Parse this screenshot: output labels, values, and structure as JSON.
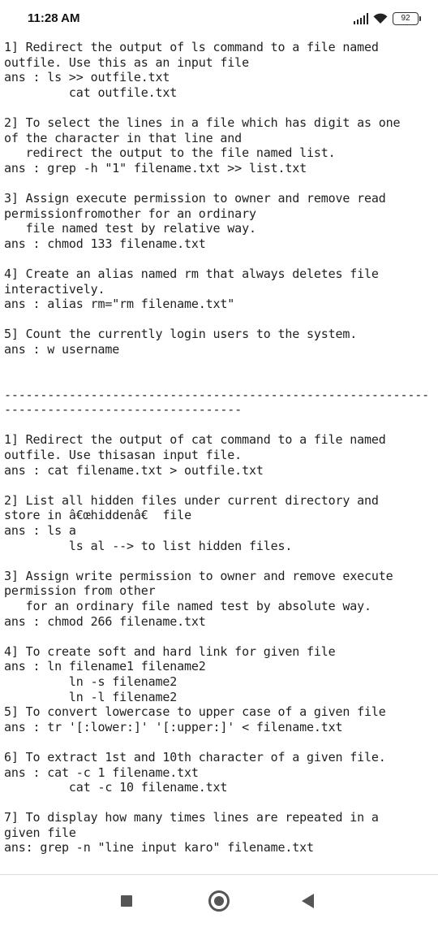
{
  "status_bar": {
    "time": "11:28 AM",
    "battery": "92"
  },
  "lines": [
    "1] Redirect the output of ls command to a file named",
    "outfile. Use this as an input file",
    "ans : ls >> outfile.txt",
    "         cat outfile.txt",
    "",
    "2] To select the lines in a file which has digit as one",
    "of the character in that line and",
    "   redirect the output to the file named list.",
    "ans : grep -h \"1\" filename.txt >> list.txt",
    "",
    "3] Assign execute permission to owner and remove read",
    "permissionfromother for an ordinary",
    "   file named test by relative way.",
    "ans : chmod 133 filename.txt",
    "",
    "4] Create an alias named rm that always deletes file",
    "interactively.",
    "ans : alias rm=\"rm filename.txt\"",
    "",
    "5] Count the currently login users to the system.",
    "ans : w username",
    "",
    "",
    "-----------------------------------------------------------",
    "---------------------------------",
    "",
    "1] Redirect the output of cat command to a file named",
    "outfile. Use thisasan input file.",
    "ans : cat filename.txt > outfile.txt",
    "",
    "2] List all hidden files under current directory and",
    "store in â€œhiddenâ€ file",
    "ans : ls a",
    "         ls al --> to list hidden files.",
    "",
    "3] Assign write permission to owner and remove execute",
    "permission from other",
    "   for an ordinary file named test by absolute way.",
    "ans : chmod 266 filename.txt",
    "",
    "4] To create soft and hard link for given file",
    "ans : ln filename1 filename2",
    "         ln -s filename2",
    "         ln -l filename2",
    "5] To convert lowercase to upper case of a given file",
    "ans : tr '[:lower:]' '[:upper:]' < filename.txt",
    "",
    "6] To extract 1st and 10th character of a given file.",
    "ans : cat -c 1 filename.txt",
    "         cat -c 10 filename.txt",
    "",
    "7] To display how many times lines are repeated in a",
    "given file",
    "ans: grep -n \"line input karo\" filename.txt"
  ]
}
